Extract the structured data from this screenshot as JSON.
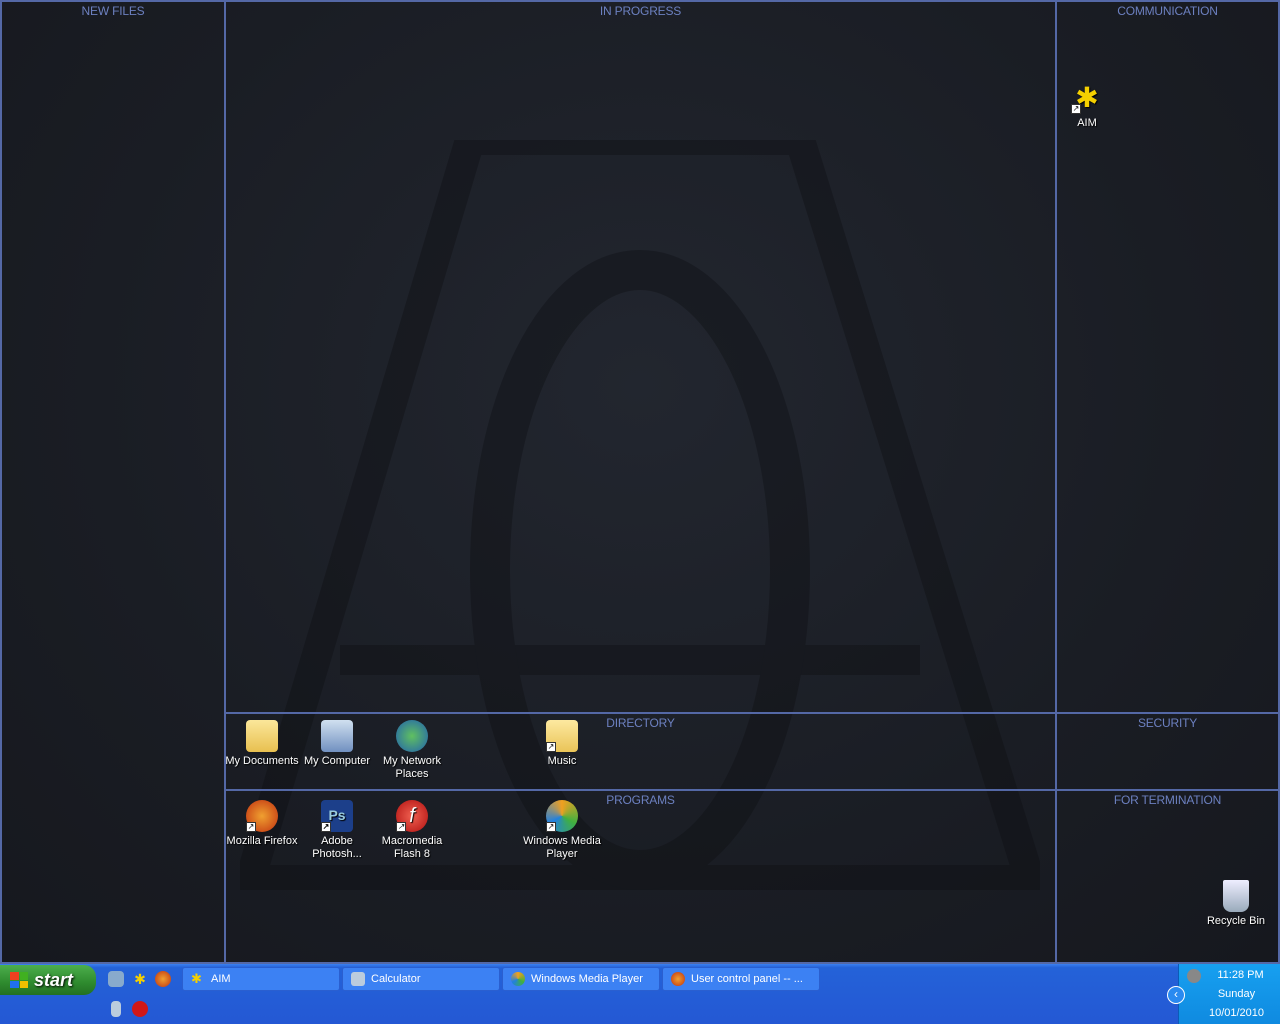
{
  "panels": {
    "new_files": "NEW FILES",
    "in_progress": "IN  PROGRESS",
    "communication": "COMMUNICATION",
    "directory": "DIRECTORY",
    "security": "SECURITY",
    "programs": "PROGRAMS",
    "for_termination": "FOR  TERMINATION"
  },
  "icons": {
    "aim": "AIM",
    "my_documents": "My Documents",
    "my_computer": "My Computer",
    "my_network": "My Network Places",
    "music": "Music",
    "firefox": "Mozilla Firefox",
    "photoshop": "Adobe Photosh...",
    "flash": "Macromedia Flash 8",
    "wmp": "Windows Media Player",
    "recycle": "Recycle Bin"
  },
  "taskbar": {
    "start": "start",
    "tasks": [
      "AIM",
      "Calculator",
      "Windows Media Player",
      "User control panel -- ..."
    ]
  },
  "tray": {
    "time": "11:28 PM",
    "day": "Sunday",
    "date": "10/01/2010"
  }
}
